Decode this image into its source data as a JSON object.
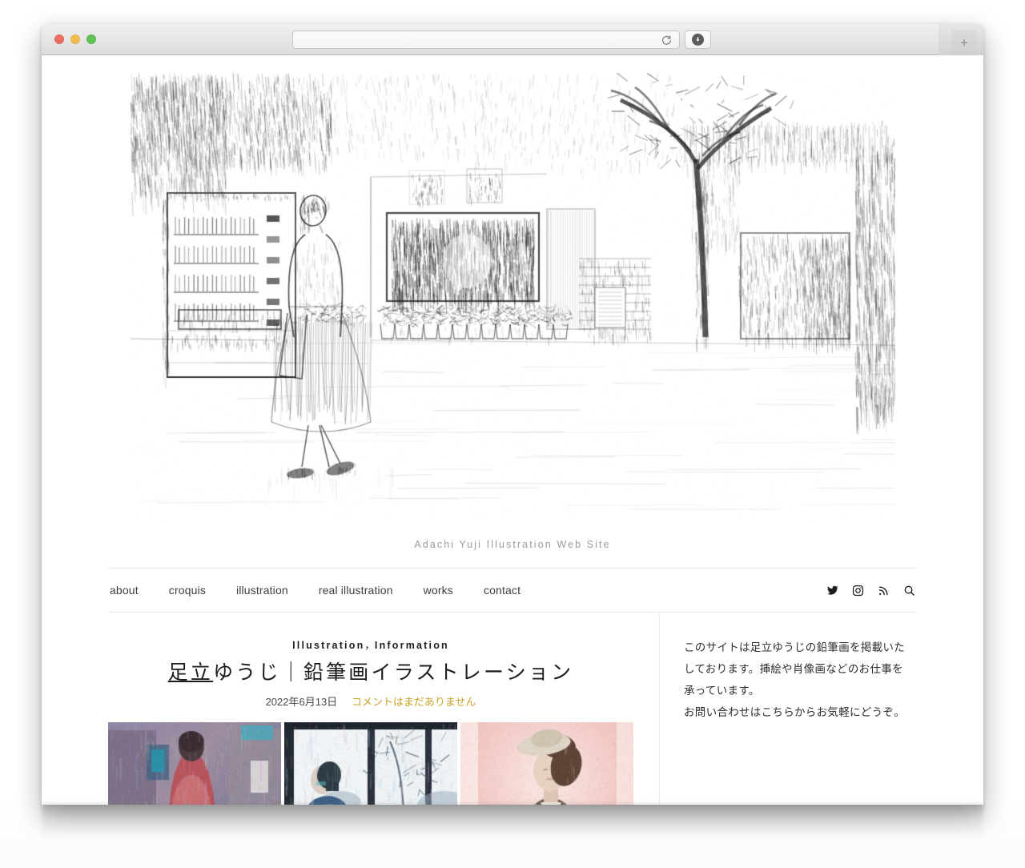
{
  "browser": {
    "traffic_lights": [
      "close",
      "minimize",
      "zoom"
    ],
    "url_value": "",
    "url_placeholder": "",
    "reload_label": "Reload",
    "download_label": "Downloads",
    "new_tab_label": "+"
  },
  "site": {
    "tagline": "Adachi Yuji Illustration Web Site",
    "hero_alt": "Pencil drawing of a woman walking past a vending machine and shop front"
  },
  "nav": {
    "items": [
      {
        "label": "about"
      },
      {
        "label": "croquis"
      },
      {
        "label": "illustration"
      },
      {
        "label": "real illustration"
      },
      {
        "label": "works"
      },
      {
        "label": "contact"
      }
    ],
    "social": [
      {
        "name": "twitter-icon"
      },
      {
        "name": "instagram-icon"
      },
      {
        "name": "rss-icon"
      },
      {
        "name": "search-icon"
      }
    ]
  },
  "post": {
    "category_1": "Illustration",
    "category_sep": "，",
    "category_2": "Information",
    "title_link": "足立",
    "title_rest": "ゆうじ｜鉛筆画イラストレーション",
    "date": "2022年6月13日",
    "comments": "コメントはまだありません",
    "comments_color": "#c9a227",
    "thumbnails": [
      {
        "alt": "Figure in red coat seen from behind on a street"
      },
      {
        "alt": "Person in blue beside a window with snowy trees"
      },
      {
        "alt": "Woman wearing a hat on a pink background"
      }
    ]
  },
  "sidebar": {
    "paragraph_1": "このサイトは足立ゆうじの鉛筆画を掲載いた",
    "paragraph_2": "しております。挿絵や肖像画などのお仕事を",
    "paragraph_3": "承っています。",
    "paragraph_4": "お問い合わせはこちらからお気軽にどうぞ。"
  }
}
